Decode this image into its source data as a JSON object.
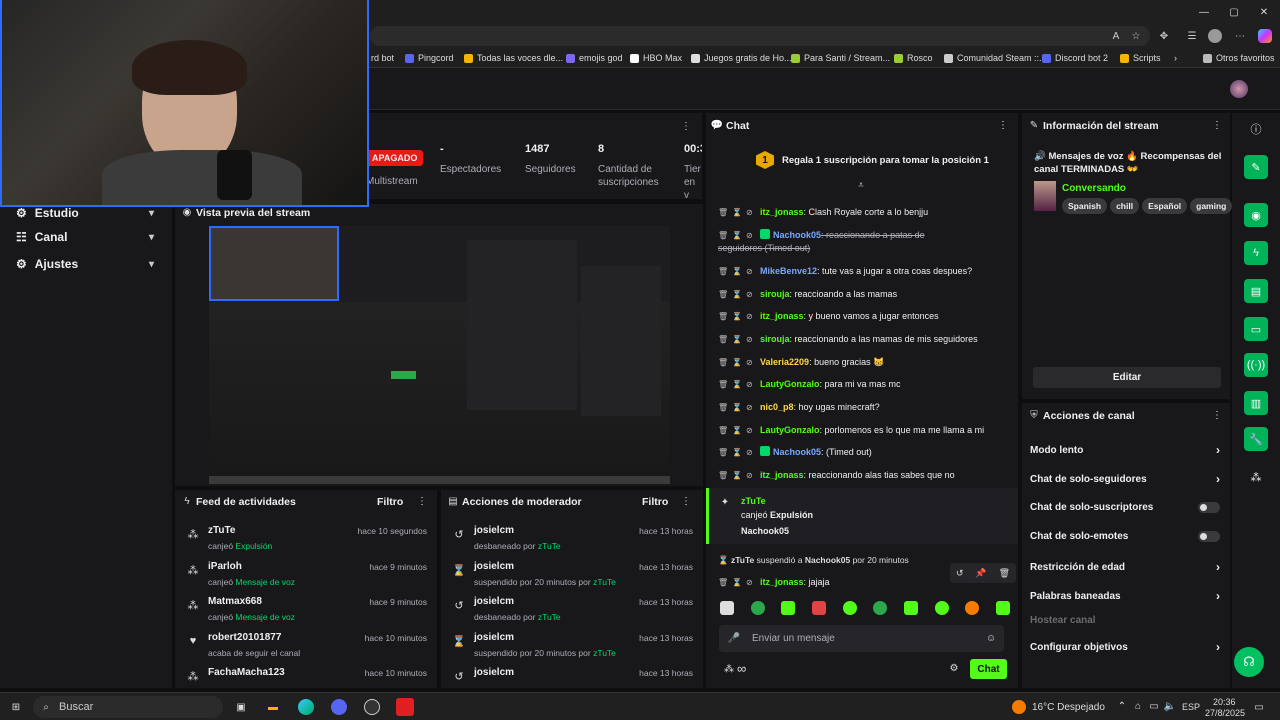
{
  "browser": {
    "bookmarks": [
      {
        "label": "rd bot",
        "color": "#5865f2"
      },
      {
        "label": "Pingcord",
        "color": "#5865f2"
      },
      {
        "label": "Todas las voces dle...",
        "color": "#f5b400"
      },
      {
        "label": "emojis god",
        "color": "#7b68ee"
      },
      {
        "label": "HBO Max",
        "color": "#ffffff"
      },
      {
        "label": "Juegos gratis de Ho...",
        "color": "#dddddd"
      },
      {
        "label": "Para Santi / Stream...",
        "color": "#9acd32"
      },
      {
        "label": "Rosco",
        "color": "#9acd32"
      },
      {
        "label": "Comunidad Steam ::...",
        "color": "#cccccc"
      },
      {
        "label": "Discord bot 2",
        "color": "#5865f2"
      },
      {
        "label": "Scripts",
        "color": "#f5b400"
      },
      {
        "label": "Otros favoritos",
        "color": "#bbbbbb"
      }
    ]
  },
  "sidebar": {
    "items": [
      {
        "label": "Estudio"
      },
      {
        "label": "Canal"
      },
      {
        "label": "Ajustes"
      }
    ]
  },
  "stats": {
    "status": "APAGADO",
    "multistream": "Multistream",
    "items": [
      {
        "value": "-",
        "label": "Espectadores"
      },
      {
        "value": "1487",
        "label": "Seguidores"
      },
      {
        "value": "8",
        "label": "Cantidad de suscripciones"
      },
      {
        "value": "00:3",
        "label": "Tier en v"
      }
    ]
  },
  "preview": {
    "title": "Vista previa del stream"
  },
  "activity": {
    "title": "Feed de actividades",
    "filter": "Filtro",
    "rows": [
      {
        "user": "zTuTe",
        "prefix": "canjeó ",
        "highlight": "Expulsión",
        "time": "hace 10 segundos"
      },
      {
        "user": "iParloh",
        "prefix": "canjeó ",
        "highlight": "Mensaje de voz",
        "time": "hace 9 minutos"
      },
      {
        "user": "Matmax668",
        "prefix": "canjeó ",
        "highlight": "Mensaje de voz",
        "time": "hace 9 minutos"
      },
      {
        "user": "robert20101877",
        "prefix": "acaba de seguir el canal",
        "highlight": "",
        "time": "hace 10 minutos"
      },
      {
        "user": "FachaMacha123",
        "prefix": "",
        "highlight": "",
        "time": "hace 10 minutos"
      }
    ]
  },
  "moderator": {
    "title": "Acciones de moderador",
    "filter": "Filtro",
    "rows": [
      {
        "user": "josielcm",
        "prefix": "desbaneado por ",
        "highlight": "zTuTe",
        "time": "hace 13 horas",
        "icon": "undo-icon"
      },
      {
        "user": "josielcm",
        "prefix": "suspendido por 20 minutos por ",
        "highlight": "zTuTe",
        "time": "hace 13 horas",
        "icon": "hourglass-icon"
      },
      {
        "user": "josielcm",
        "prefix": "desbaneado por ",
        "highlight": "zTuTe",
        "time": "hace 13 horas",
        "icon": "undo-icon"
      },
      {
        "user": "josielcm",
        "prefix": "suspendido por 20 minutos por ",
        "highlight": "zTuTe",
        "time": "hace 13 horas",
        "icon": "hourglass-icon"
      },
      {
        "user": "josielcm",
        "prefix": "",
        "highlight": "",
        "time": "hace 13 horas",
        "icon": "undo-icon"
      }
    ]
  },
  "chat": {
    "title": "Chat",
    "pinned": "Regala 1 suscripción para tomar la posición 1",
    "pinned_rank": "1",
    "messages": [
      {
        "user": "itz_jonass",
        "color": "#53fc18",
        "text": ": Clash Royale corte a lo benjju",
        "sub": false
      },
      {
        "user": "Nachook05",
        "color": "#7aa8ff",
        "text": ": reaccionando a patas de",
        "sub": true,
        "deleted": true
      },
      {
        "user": "",
        "color": "#adadb8",
        "text": "seguidores (Timed out)",
        "cont": true
      },
      {
        "user": "MikeBenve12",
        "color": "#7aa8ff",
        "text": ": tute vas a jugar a otra coas despues?"
      },
      {
        "user": "sirouja",
        "color": "#53fc18",
        "text": ": reaccioando a las mamas"
      },
      {
        "user": "itz_jonass",
        "color": "#53fc18",
        "text": ": y bueno vamos a jugar entonces"
      },
      {
        "user": "sirouja",
        "color": "#53fc18",
        "text": ": reaccionando a las mamas de mis seguidores"
      },
      {
        "user": "Valeria2209",
        "color": "#ffd84a",
        "text": ": bueno gracias 😸"
      },
      {
        "user": "LautyGonzalo",
        "color": "#53fc18",
        "text": ": para mi va mas mc"
      },
      {
        "user": "nic0_p8",
        "color": "#ffd84a",
        "text": ": hoy ugas minecraft?"
      },
      {
        "user": "LautyGonzalo",
        "color": "#53fc18",
        "text": ": porlomenos es lo que ma me llama a mi"
      },
      {
        "user": "Nachook05",
        "color": "#7aa8ff",
        "text": ": (Timed out)",
        "sub": true
      },
      {
        "user": "itz_jonass",
        "color": "#53fc18",
        "text": ": reaccionando alas tias sabes que no"
      }
    ],
    "redeem": {
      "user": "zTuTe",
      "prefix": "canjeó ",
      "reward": "Expulsión",
      "target": "Nachook05"
    },
    "suspend_note": {
      "actor": "zTuTe",
      "text": " suspendió a ",
      "target": "Nachook05",
      "suffix": " por 20 minutos"
    },
    "last_message": {
      "user": "itz_jonass",
      "text": ": jajaja"
    },
    "input_placeholder": "Enviar un mensaje",
    "send_label": "Chat",
    "infinity": "∞"
  },
  "stream_info": {
    "title": "Información del stream",
    "stream_title": "🔊 Mensajes de voz 🔥 Recompensas del canal TERMINADAS 👐",
    "category": "Conversando",
    "tags": [
      "Spanish",
      "chill",
      "Español",
      "gaming"
    ],
    "edit_label": "Editar"
  },
  "channel_actions": {
    "title": "Acciones de canal",
    "items": [
      {
        "label": "Modo lento",
        "control": "chevron"
      },
      {
        "label": "Chat de solo-seguidores",
        "control": "chevron"
      },
      {
        "label": "Chat de solo-suscriptores",
        "control": "toggle"
      },
      {
        "label": "Chat de solo-emotes",
        "control": "toggle"
      },
      {
        "label": "Restricción de edad",
        "control": "chevron"
      },
      {
        "label": "Palabras baneadas",
        "control": "chevron"
      },
      {
        "label": "Hostear canal",
        "control": "none",
        "disabled": true
      },
      {
        "label": "Configurar objetivos",
        "control": "chevron"
      }
    ]
  },
  "taskbar": {
    "search": "Buscar",
    "weather": "16°C Despejado",
    "lang": "ESP",
    "time": "20:36",
    "date": "27/8/2025"
  }
}
